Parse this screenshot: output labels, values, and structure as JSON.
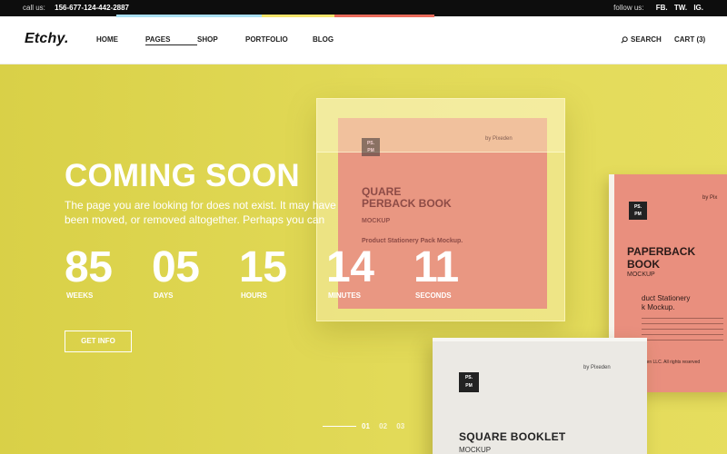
{
  "topbar": {
    "call_label": "call us:",
    "phone": "156-677-124-442-2887",
    "follow_label": "follow us:",
    "social": [
      "FB.",
      "TW.",
      "IG."
    ]
  },
  "header": {
    "logo": "Etchy.",
    "nav": [
      "HOME",
      "PAGES",
      "SHOP",
      "PORTFOLIO",
      "BLOG"
    ],
    "active_nav": "PAGES",
    "search_label": "SEARCH",
    "cart_label": "CART (3)"
  },
  "hero": {
    "title": "COMING SOON",
    "description": "The page you are looking for does not exist. It may have been moved, or removed altogether. Perhaps you can",
    "countdown": [
      {
        "value": "85",
        "unit": "WEEKS"
      },
      {
        "value": "05",
        "unit": "DAYS"
      },
      {
        "value": "15",
        "unit": "HOURS"
      },
      {
        "value": "14",
        "unit": "MINUTES"
      },
      {
        "value": "11",
        "unit": "SECONDS"
      }
    ],
    "button_label": "GET INFO",
    "slides": [
      "01",
      "02",
      "03"
    ],
    "active_slide": "01"
  },
  "mockups": {
    "pink": {
      "logo": "PS.\nPM",
      "by": "by Pixeden",
      "title": "QUARE\nPERBACK BOOK",
      "sub": "MOCKUP",
      "desc": "Product Stationery Pack Mockup."
    },
    "red": {
      "logo": "PS.\nPM",
      "by": "by Pix",
      "title": "PAPERBACK\nBOOK",
      "sub": "MOCKUP",
      "desc": "duct Stationery\nk Mockup.",
      "copy": "eden LLC. All rights reserved"
    },
    "white": {
      "logo": "PS.\nPM",
      "by": "by Pixeden",
      "title": "SQUARE BOOKLET",
      "sub": "MOCKUP"
    }
  },
  "colors": {
    "hero_bg": "#e2da58",
    "topbar_bg": "#0d0d0d",
    "accent_blue": "#a9dff2",
    "accent_red": "#ea6b5b"
  }
}
